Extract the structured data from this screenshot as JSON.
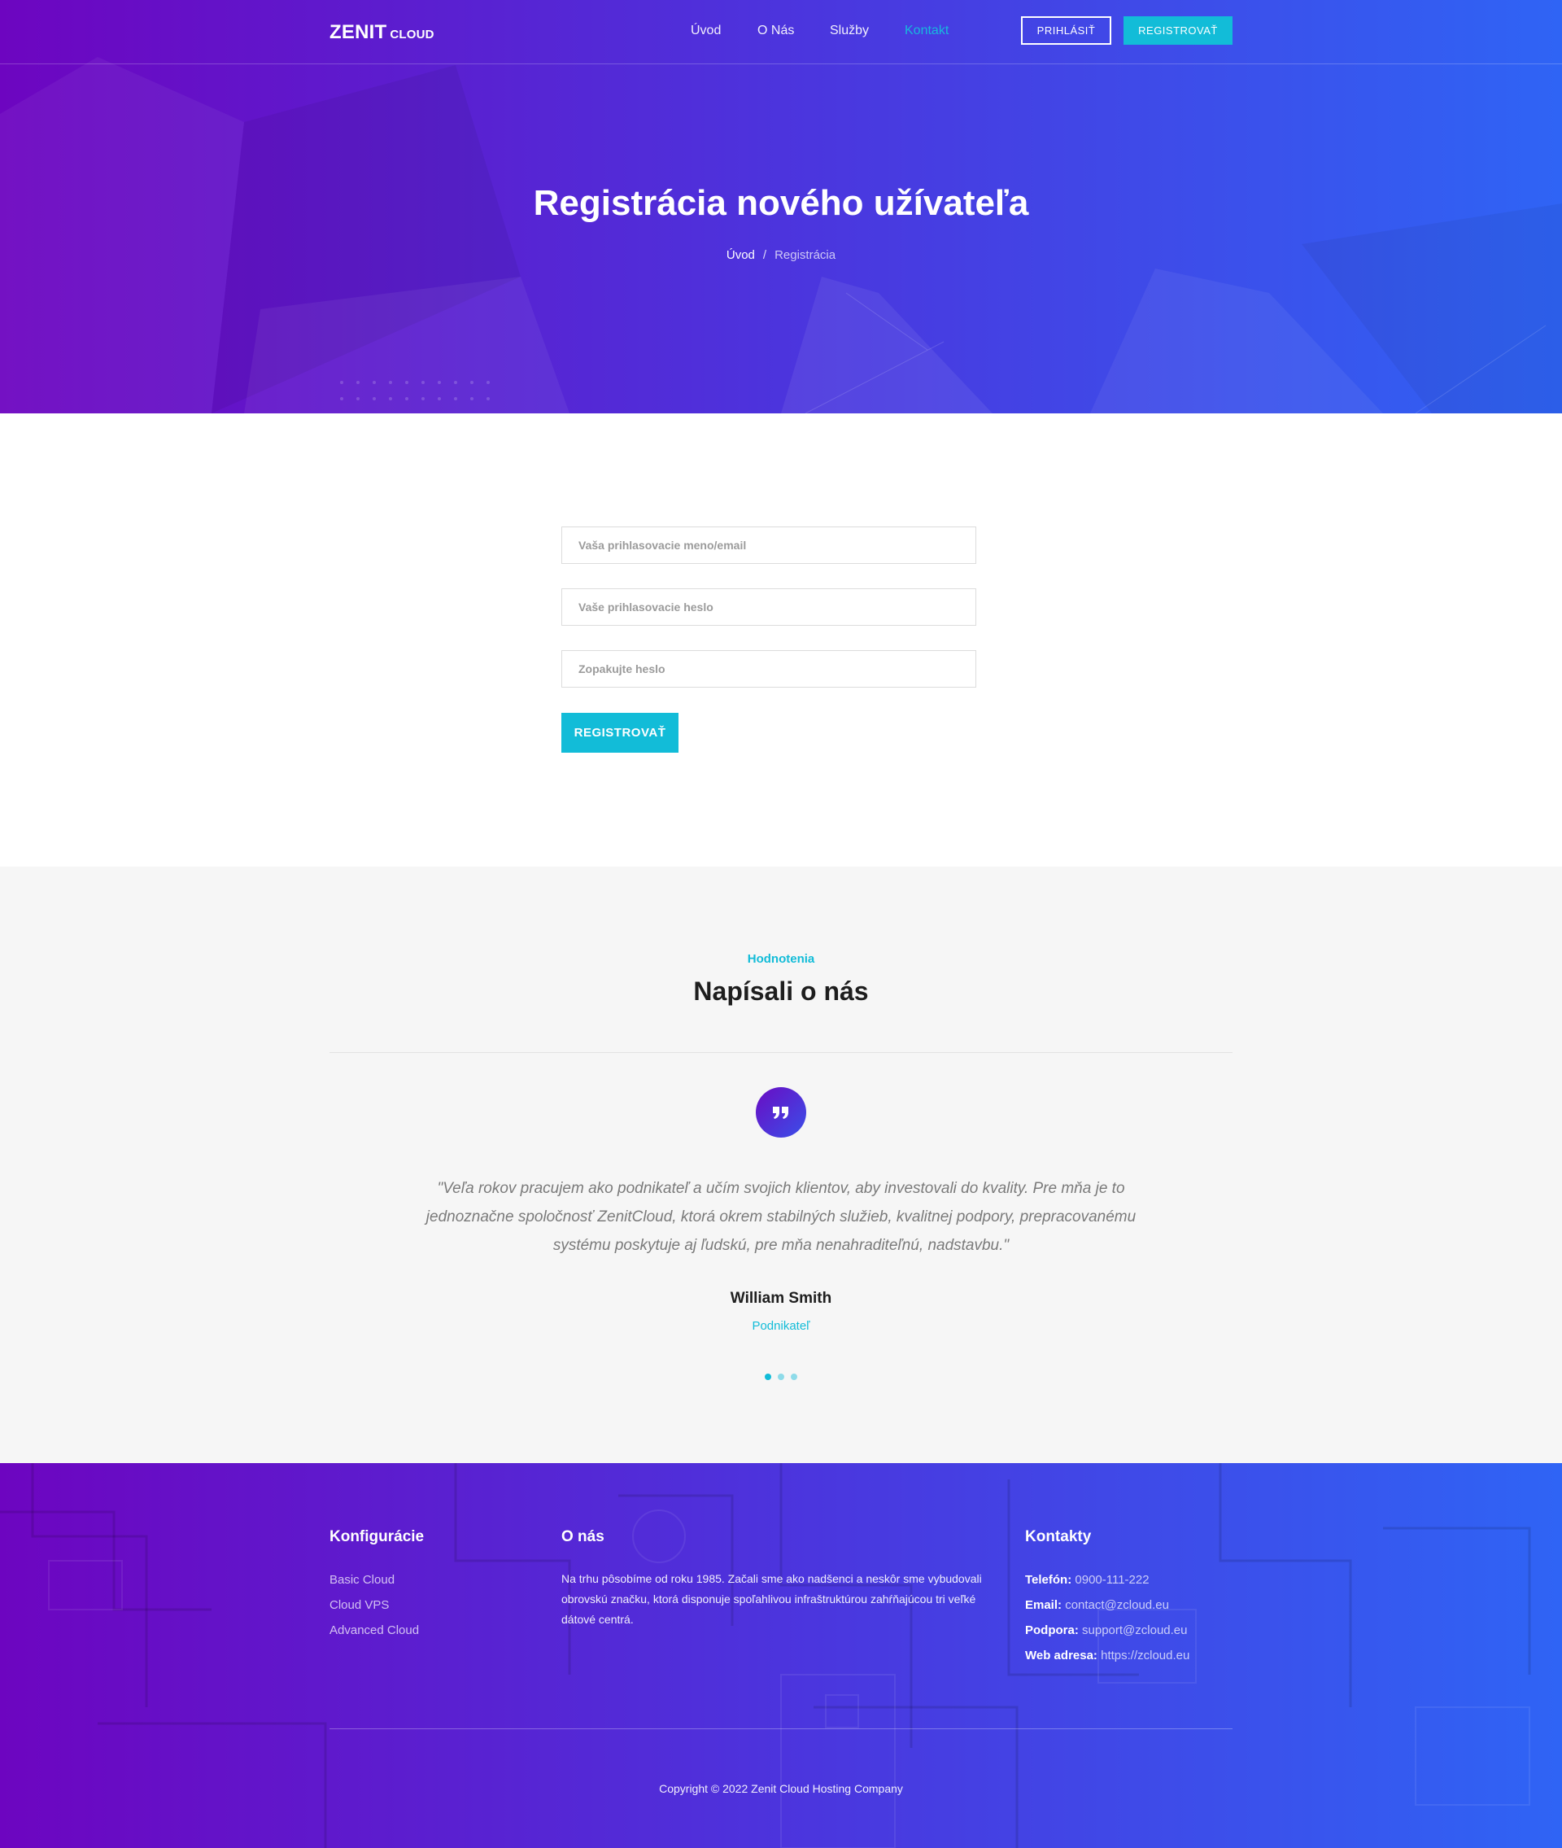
{
  "brand": {
    "name": "ZENIT",
    "sub": "CLOUD"
  },
  "nav": {
    "items": [
      "Úvod",
      "O Nás",
      "Služby",
      "Kontakt"
    ],
    "active": "Kontakt",
    "login_label": "PRIHLÁSIŤ",
    "register_label": "REGISTROVAŤ"
  },
  "hero": {
    "title": "Registrácia nového užívateľa",
    "breadcrumb": [
      "Úvod",
      "Registrácia"
    ],
    "breadcrumb_separator": "/"
  },
  "form": {
    "username_placeholder": "Vaša prihlasovacie meno/email",
    "password_placeholder": "Vaše prihlasovacie heslo",
    "password_repeat_placeholder": "Zopakujte heslo",
    "submit_label": "REGISTROVAŤ"
  },
  "testimonials": {
    "kicker": "Hodnotenia",
    "title": "Napísali o nás",
    "quote": "\"Veľa rokov pracujem ako podnikateľ a učím svojich klientov, aby investovali do kvality. Pre mňa je to jednoznačne spoločnosť ZenitCloud, ktorá okrem stabilných služieb, kvalitnej podpory, prepracovanému systému poskytuje aj ľudskú, pre mňa nenahraditeľnú, nadstavbu.\"",
    "author": "William Smith",
    "role": "Podnikateľ",
    "slides": 3,
    "active_slide": 1,
    "icon": "quote-icon"
  },
  "footer": {
    "configs": {
      "title": "Konfigurácie",
      "items": [
        "Basic Cloud",
        "Cloud VPS",
        "Advanced Cloud"
      ]
    },
    "about": {
      "title": "O nás",
      "text": "Na trhu pôsobíme od roku 1985. Začali sme ako nadšenci a neskôr sme vybudovali obrovskú značku, ktorá disponuje spoľahlivou infraštruktúrou zahŕňajúcou tri veľké dátové centrá."
    },
    "contacts": {
      "title": "Kontakty",
      "phone_label": "Telefón:",
      "phone": "0900-111-222",
      "email_label": "Email:",
      "email": "contact@zcloud.eu",
      "support_label": "Podpora:",
      "support": "support@zcloud.eu",
      "web_label": "Web adresa:",
      "web": "https://zcloud.eu"
    },
    "copyright": "Copyright © 2022 Zenit Cloud Hosting Company"
  },
  "colors": {
    "gradient_start": "#6d05c0",
    "gradient_end": "#2f64f5",
    "accent": "#12bcd8",
    "section_bg": "#f6f6f6",
    "heading": "#1e1e1e"
  }
}
